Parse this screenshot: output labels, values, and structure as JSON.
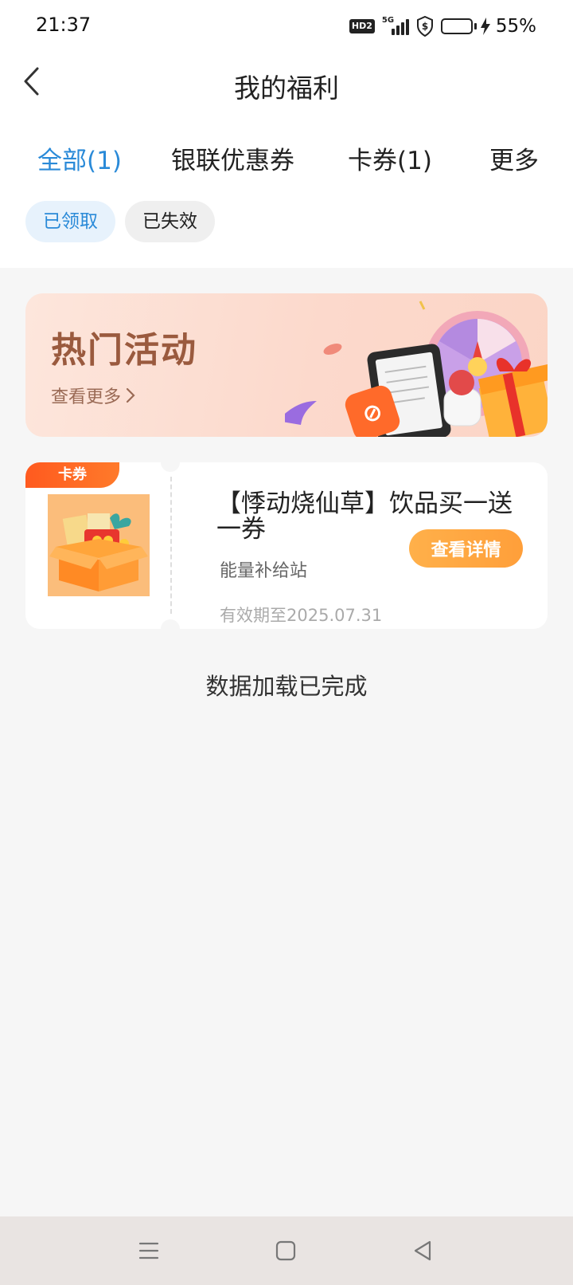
{
  "status_bar": {
    "time": "21:37",
    "hd_label": "HD2",
    "network": "5G",
    "battery_percent": "55%",
    "battery_level": 0.55
  },
  "header": {
    "title": "我的福利"
  },
  "tabs": [
    {
      "label": "全部(1)",
      "active": true
    },
    {
      "label": "银联优惠券",
      "active": false
    },
    {
      "label": "卡券(1)",
      "active": false
    },
    {
      "label": "更多",
      "active": false
    }
  ],
  "filters": [
    {
      "label": "已领取",
      "selected": true
    },
    {
      "label": "已失效",
      "selected": false
    }
  ],
  "banner": {
    "title": "热门活动",
    "more_label": "查看更多"
  },
  "coupon": {
    "tag": "卡券",
    "title": "【悸动烧仙草】饮品买一送一券",
    "merchant": "能量补给站",
    "expiry": "有效期至2025.07.31",
    "button": "查看详情"
  },
  "footer_text": "数据加载已完成",
  "colors": {
    "accent_blue": "#2a8ad8",
    "orange_button": "#ffa843",
    "tag_orange": "#ff5a1f",
    "banner_title": "#9a5a3e",
    "page_bg": "#f6f6f6"
  },
  "nav_bar": {
    "buttons": [
      "menu-icon",
      "home-square-icon",
      "back-triangle-icon"
    ]
  }
}
